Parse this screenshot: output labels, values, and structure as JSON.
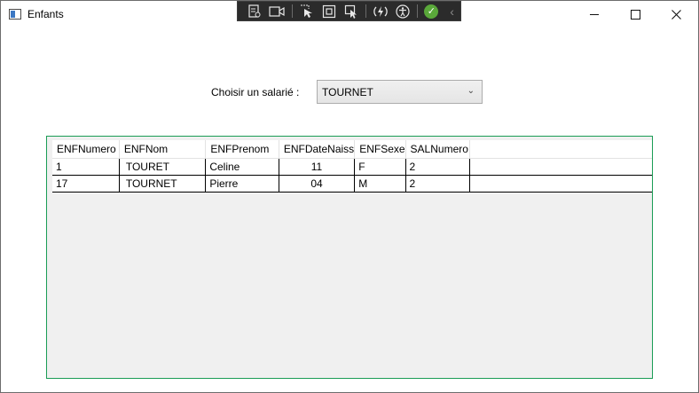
{
  "window": {
    "title": "Enfants"
  },
  "form": {
    "choose_label": "Choisir un salarié :",
    "selected_salarie": "TOURNET"
  },
  "table": {
    "columns": [
      "ENFNumero",
      "ENFNom",
      "ENFPrenom",
      "ENFDateNaiss",
      "ENFSexe",
      "SALNumero"
    ],
    "rows": [
      [
        "1",
        "TOURET",
        "Celine",
        "11",
        "F",
        "2"
      ],
      [
        "17",
        "TOURNET",
        "Pierre",
        "04",
        "M",
        "2"
      ]
    ]
  },
  "icons": {
    "titlebar": [
      "app-icon",
      "minimize-icon",
      "maximize-icon",
      "close-icon"
    ],
    "devtools": [
      "live-visual-tree-icon",
      "video-icon",
      "select-element-icon",
      "display-layout-adorners-icon",
      "track-focus-icon",
      "hot-reload-icon",
      "accessibility-icon",
      "binding-check-icon",
      "collapse-chevron-icon"
    ]
  },
  "colors": {
    "grid_border": "#1a9c55",
    "grid_background": "#f0f0f0",
    "toolbar_background": "#2b2b2b"
  }
}
